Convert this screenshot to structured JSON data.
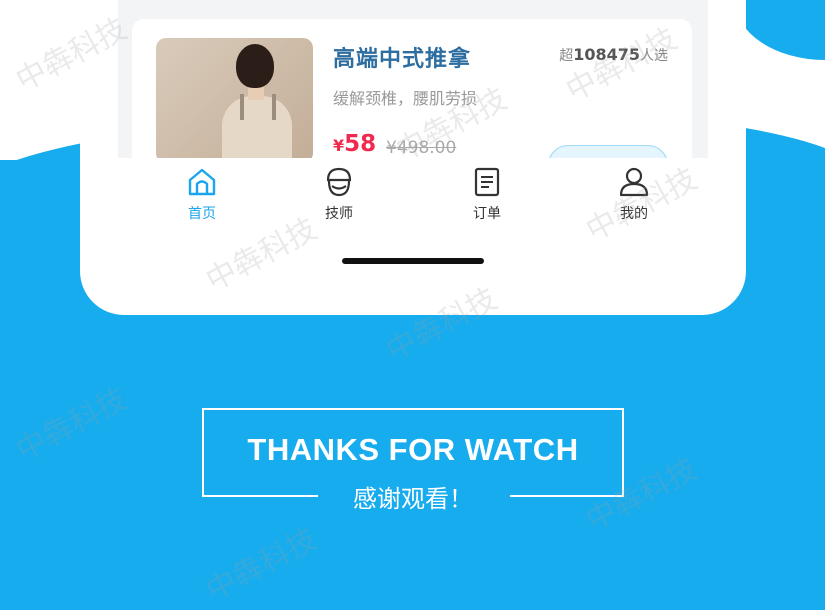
{
  "product": {
    "title": "高端中式推拿",
    "description": "缓解颈椎，腰肌劳损",
    "sold_prefix": "超",
    "sold_count": "108475",
    "sold_suffix": "人选",
    "price_symbol": "¥",
    "price": "58",
    "original_price": "¥498.00"
  },
  "tabbar": {
    "items": [
      {
        "label": "首页",
        "icon": "home-icon",
        "active": true
      },
      {
        "label": "技师",
        "icon": "technician-icon",
        "active": false
      },
      {
        "label": "订单",
        "icon": "order-icon",
        "active": false
      },
      {
        "label": "我的",
        "icon": "profile-icon",
        "active": false
      }
    ]
  },
  "thanks": {
    "english": "THANKS FOR WATCH",
    "chinese": "感谢观看！"
  },
  "watermark": "中犇科技",
  "colors": {
    "background_blue": "#16acee",
    "title_blue": "#2e6da0",
    "price_red": "#f02a4e",
    "active_tab": "#1aa5ec"
  }
}
